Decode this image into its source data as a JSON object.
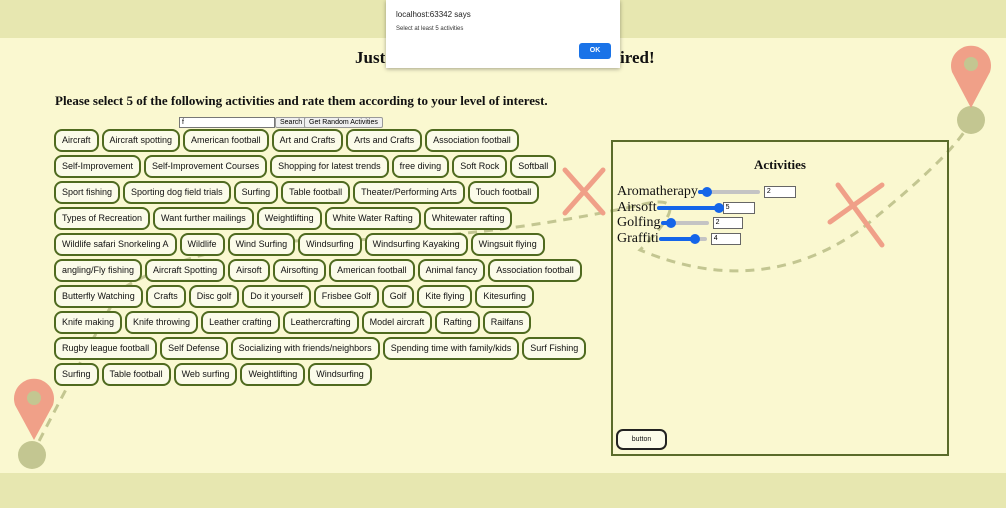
{
  "page": {
    "title_left": "Just",
    "title_right": "ired!",
    "instruction": "Please select 5 of the following activities and rate them according to your level of interest."
  },
  "search": {
    "value": "f",
    "button_label": "Search",
    "random_label": "Get Random Activities"
  },
  "activity_rows": [
    [
      "Aircraft",
      "Aircraft spotting",
      "American football",
      "Art and Crafts",
      "Arts and Crafts",
      "Association football"
    ],
    [
      "Self-Improvement",
      "Self-Improvement Courses",
      "Shopping for latest trends",
      "free diving",
      "Soft Rock",
      "Softball"
    ],
    [
      "Sport fishing",
      "Sporting dog field trials",
      "Surfing",
      "Table football",
      "Theater/Performing Arts",
      "Touch football"
    ],
    [
      "Types of Recreation",
      "Want further mailings",
      "Weightlifting",
      "White Water Rafting",
      "Whitewater rafting"
    ],
    [
      "Wildlife safari Snorkeling A",
      "Wildlife",
      "Wind Surfing",
      "Windsurfing",
      "Windsurfing Kayaking",
      "Wingsuit flying"
    ],
    [
      "angling/Fly fishing",
      "Aircraft Spotting",
      "Airsoft",
      "Airsofting",
      "American football",
      "Animal fancy",
      "Association football"
    ],
    [
      "Butterfly Watching",
      "Crafts",
      "Disc golf",
      "Do it yourself",
      "Frisbee Golf",
      "Golf",
      "Kite flying",
      "Kitesurfing"
    ],
    [
      "Knife making",
      "Knife throwing",
      "Leather crafting",
      "Leathercrafting",
      "Model aircraft",
      "Rafting",
      "Railfans"
    ],
    [
      "Rugby league football",
      "Self Defense",
      "Socializing with friends/neighbors",
      "Spending time with family/kids",
      "Surf Fishing"
    ],
    [
      "Surfing",
      "Table football",
      "Web surfing",
      "Weightlifting",
      "Windsurfing"
    ]
  ],
  "panel": {
    "title": "Activities",
    "ratings": [
      {
        "name": "Aromatherapy",
        "value": "2",
        "level": 0.15
      },
      {
        "name": "Airsoft",
        "value": "5",
        "level": 1.0
      },
      {
        "name": "Golfing",
        "value": "2",
        "level": 0.2
      },
      {
        "name": "Graffiti",
        "value": "4",
        "level": 0.75
      }
    ],
    "button_label": "button"
  },
  "dialog": {
    "title": "localhost:63342 says",
    "message": "Select at least 5 activities",
    "ok_label": "OK"
  },
  "colors": {
    "accent": "#1565e9",
    "button_border": "#4f6a1f",
    "pin": "#f0a088",
    "pin_base": "#c3c691"
  }
}
